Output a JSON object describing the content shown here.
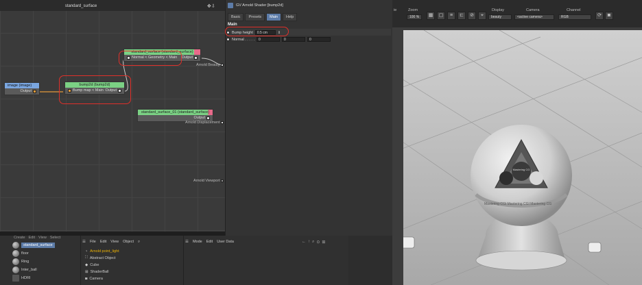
{
  "node_editor": {
    "title": "standard_surface",
    "nodes": {
      "image": {
        "title": "image (image)",
        "output": "Output"
      },
      "bump": {
        "title": "bump2d (bump2d)",
        "input": "Bump map < Main",
        "output": "Output"
      },
      "standard_surface": {
        "title": "standard_surface (standard_surface)",
        "input": "Normal < Geometry < Main",
        "output": "Output"
      },
      "standard_surface_01": {
        "title": "standard_surface_01 (standard_surface)",
        "output": "Output"
      }
    },
    "labels": {
      "arnold_beauty": "Arnold Beauty",
      "arnold_displacement": "Arnold Displacement",
      "arnold_viewport": "Arnold Viewport"
    }
  },
  "attribute_panel": {
    "title": "GV Arnold Shader [bump2d]",
    "tabs": [
      "Basic",
      "Presets",
      "Main",
      "Help"
    ],
    "active_tab": "Main",
    "section": "Main",
    "bump_height": {
      "label": "Bump height",
      "value": "0.5 cm"
    },
    "normal": {
      "label": "Normal . . . . .",
      "values": [
        "0",
        "0",
        "0"
      ]
    }
  },
  "toolbar": {
    "zoom_label": "Zoom",
    "zoom_value": "100 %",
    "display_label": "Display",
    "display_value": "beauty",
    "camera_label": "Camera",
    "camera_value": "<active camera>",
    "channel_label": "Channel",
    "channel_value": "RGB",
    "left_value": "ie"
  },
  "materials": {
    "items": [
      "standard_surface",
      "floor",
      "Ring",
      "Inter_ball",
      "HDRI"
    ],
    "selected": "standard_surface",
    "menu": [
      "Create",
      "Edit",
      "View",
      "Select"
    ]
  },
  "objects": {
    "menu": [
      "File",
      "Edit",
      "View",
      "Object"
    ],
    "items": [
      "Arnold point_light",
      "Abstract Object",
      "Cube",
      "ShaderBall",
      "Camera"
    ],
    "active": "Arnold point_light"
  },
  "attributes_bottom": {
    "menu": [
      "Mode",
      "Edit",
      "User Data"
    ]
  },
  "viewport": {
    "badge_text": "Mastering CG",
    "ring_text": "Mastering CGI   Mastering CGI   Mastering CG"
  },
  "colors": {
    "highlight": "#e0302a",
    "active_tab": "#5d7ca8",
    "node_header_green": "#7bd184",
    "node_header_pink": "#e86a8a",
    "node_header_blue": "#7aa6e0"
  }
}
